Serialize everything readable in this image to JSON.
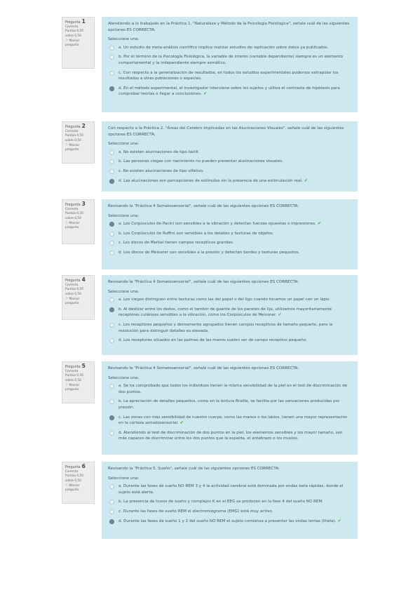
{
  "labels": {
    "question": "Pregunta",
    "state": "Correcta",
    "flag": "Marcar pregunta",
    "choose": "Seleccione una:"
  },
  "questions": [
    {
      "number": "1",
      "score": "Puntúa 0,50 sobre 0,50",
      "text": "Atendiendo a lo trabajado en la Práctica 1, \"Naturaleza y Método de la Psicología Fisiológica\", señale cuál de las siguientes opciones ES CORRECTA:",
      "options": [
        {
          "text": "a. Un estudio de meta-análisis científico implica realizar estudios de replicación sobre datos ya publicados.",
          "selected": false,
          "correct": false
        },
        {
          "text": "b. Por el término de la Psicología Fisiológica, la variable de interés (variable dependiente) siempre es un elemento comportamental y la independiente siempre somático.",
          "selected": false,
          "correct": false
        },
        {
          "text": "c. Con respecto a la generalización de resultados, en todos los estudios experimentales podemos extrapolar los resultados a otras poblaciones o especies.",
          "selected": false,
          "correct": false
        },
        {
          "text": "d. En el método experimental, el investigador interviene sobre los sujetos y utiliza el contraste de hipótesis para comprobar teorías o llegar a conclusiones.",
          "selected": true,
          "correct": true
        }
      ]
    },
    {
      "number": "2",
      "score": "Puntúa 0,50 sobre 0,50",
      "text": "Con respecto a la Práctica 2, \"Áreas del Cerebro Implicadas en las Alucinaciones Visuales\", señale cuál de las siguientes opciones ES CORRECTA:",
      "options": [
        {
          "text": "a. No existen alucinaciones de tipo táctil.",
          "selected": false,
          "correct": false
        },
        {
          "text": "b. Las personas ciegas con nacimiento no pueden presentar alucinaciones visuales.",
          "selected": false,
          "correct": false
        },
        {
          "text": "c. No existen alucinaciones de tipo olfativo.",
          "selected": false,
          "correct": false
        },
        {
          "text": "d. Las alucinaciones son percepciones de estímulos sin la presencia de una estimulación real.",
          "selected": true,
          "correct": true
        }
      ]
    },
    {
      "number": "3",
      "score": "Puntúa 0,50 sobre 0,50",
      "text": "Revisando la \"Práctica 4 Somatosensorial\", señale cuál de las siguientes opciones ES CORRECTA:",
      "options": [
        {
          "text": "a. Los Corpúsculos de Pacini son sensibles a la vibración y detectan fuerzas opuestas o impresiones.",
          "selected": true,
          "correct": true
        },
        {
          "text": "b. Los Corpúsculos de Ruffini son sensibles a los detalles y texturas de objetos.",
          "selected": false,
          "correct": false
        },
        {
          "text": "c. Los discos de Merkel tienen campos receptivos grandes.",
          "selected": false,
          "correct": false
        },
        {
          "text": "d. Los discos de Meissner son sensibles a la presión y detectan bordes y texturas pequeños.",
          "selected": false,
          "correct": false
        }
      ]
    },
    {
      "number": "4",
      "score": "Puntúa 0,50 sobre 0,50",
      "text": "Revisando la \"Práctica 4 Somatosensorial\", señale cuál de las siguientes opciones ES CORRECTA:",
      "options": [
        {
          "text": "a. Los ciegos distinguen entre texturas como las del papel o del ligo cuando tocamos un papel con un lápiz.",
          "selected": false,
          "correct": false
        },
        {
          "text": "b. Al deslizar entre los dedos, como el tambor de guante de los paneles de lija, utilizamos mayoritariamente receptores cutáneos sensibles a la vibración, como los Corpúsculos de Meissner.",
          "selected": true,
          "correct": true
        },
        {
          "text": "c. Los receptores pequeños y densamente agrupados tienen campos receptivos de tamaño pequeño, pero la resolución para distinguir detalles es elevada.",
          "selected": false,
          "correct": false
        },
        {
          "text": "d. Los receptores situados en las palmas de las manos suelen ser de campo receptivo pequeño.",
          "selected": false,
          "correct": false
        }
      ]
    },
    {
      "number": "5",
      "score": "Puntúa 0,50 sobre 0,50",
      "text": "Revisando la \"Práctica 4 Somatosensorial\", señale cuál de las siguientes opciones ES CORRECTA:",
      "options": [
        {
          "text": "a. Se ha comprobado que todos los individuos tienen la misma sensibilidad de la piel en el test de discriminación de dos puntos.",
          "selected": false,
          "correct": false
        },
        {
          "text": "b. La apreciación de detalles pequeños, como en la lectura Braille, se facilita por las sensaciones producidas por presión.",
          "selected": false,
          "correct": false
        },
        {
          "text": "c. Las zonas con más sensibilidad de nuestro cuerpo, como las manos o los labios, tienen una mayor representación en la corteza somatosensorial.",
          "selected": true,
          "correct": true
        },
        {
          "text": "d. Atendiendo al test de discriminación de dos puntos en la piel, los elementos sensibles y los mayor tamaño, son más capaces de discriminar entre los dos puntos que la espalda, el antebrazo o los muslos.",
          "selected": false,
          "correct": false
        }
      ]
    },
    {
      "number": "6",
      "score": "Puntúa 0,50 sobre 0,50",
      "text": "Revisando la \"Práctica 5. Sueño\", señale cuál de las siguientes opciones ES CORRECTA:",
      "options": [
        {
          "text": "a. Durante las fases de sueño NO REM 3 y 4 la actividad cerebral está dominada por ondas beta rápidas, donde el sujeto está alerta.",
          "selected": false,
          "correct": false
        },
        {
          "text": "b. La presencia de husos de sueño y complejos K en el EEG se producen en la fase 4 del sueño NO REM.",
          "selected": false,
          "correct": false
        },
        {
          "text": "c. Durante las fases de sueño REM el electromiograma (EMG) está muy activo.",
          "selected": false,
          "correct": false
        },
        {
          "text": "d. Durante las fases de sueño 1 y 2 del sueño NO REM el sujeto comienza a presentar las ondas lentas (theta).",
          "selected": true,
          "correct": true
        }
      ]
    }
  ]
}
